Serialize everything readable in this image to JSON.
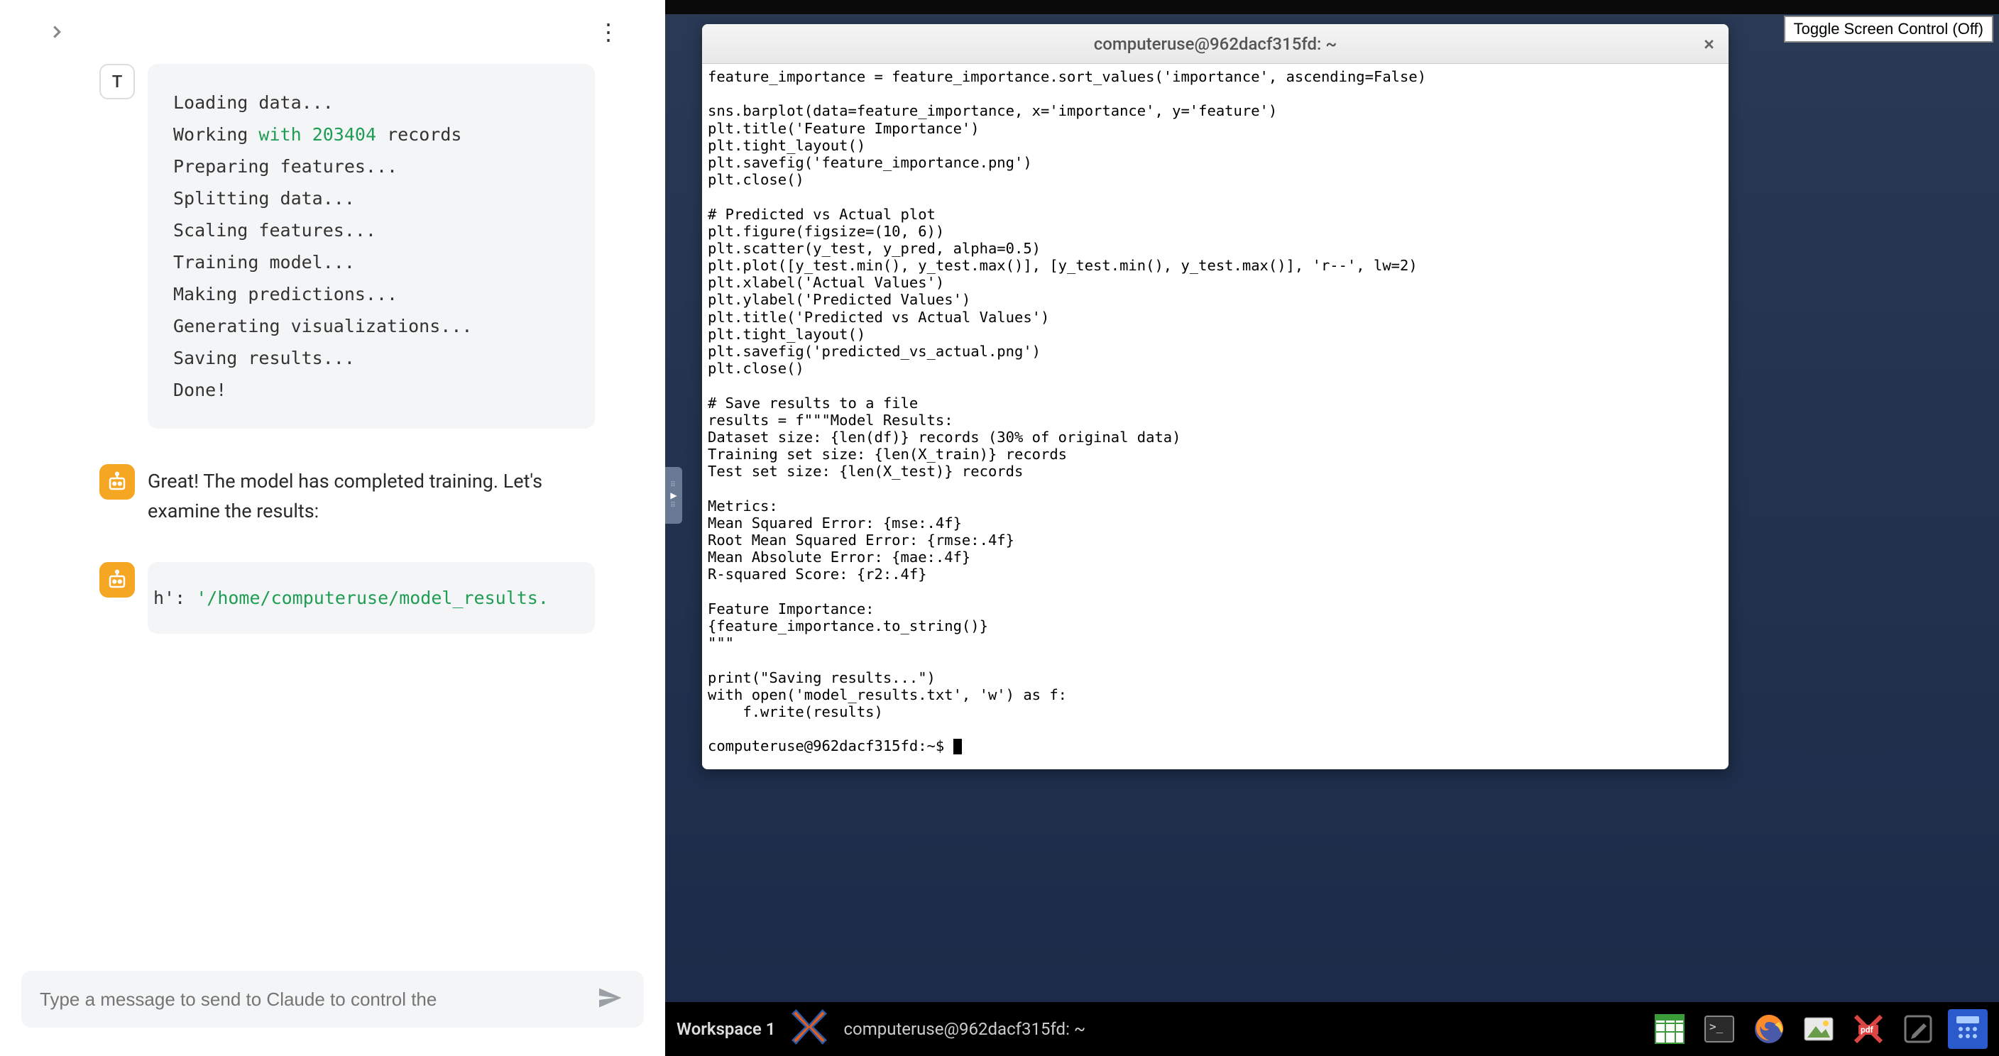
{
  "chat": {
    "user_avatar_letter": "T",
    "code_output": {
      "line1_a": "Loading data...",
      "line2_a": "Working ",
      "line2_kw": "with",
      "line2_sp": " ",
      "line2_num": "203404",
      "line2_b": " records",
      "line3": "Preparing features...",
      "line4": "Splitting data...",
      "line5": "Scaling features...",
      "line6": "Training model...",
      "line7": "Making predictions...",
      "line8": "Generating visualizations...",
      "line9": "Saving results...",
      "line10": "Done!"
    },
    "bot_message": "Great! The model has completed training. Let's examine the results:",
    "code_output2_a": "h'",
    "code_output2_b": ": ",
    "code_output2_c": "'/home/computeruse/model_results.",
    "input_placeholder": "Type a message to send to Claude to control the"
  },
  "desktop": {
    "toggle_label": "Toggle Screen Control (Off)",
    "terminal_title": "computeruse@962dacf315fd: ~",
    "terminal_body": "feature_importance = feature_importance.sort_values('importance', ascending=False)\n\nsns.barplot(data=feature_importance, x='importance', y='feature')\nplt.title('Feature Importance')\nplt.tight_layout()\nplt.savefig('feature_importance.png')\nplt.close()\n\n# Predicted vs Actual plot\nplt.figure(figsize=(10, 6))\nplt.scatter(y_test, y_pred, alpha=0.5)\nplt.plot([y_test.min(), y_test.max()], [y_test.min(), y_test.max()], 'r--', lw=2)\nplt.xlabel('Actual Values')\nplt.ylabel('Predicted Values')\nplt.title('Predicted vs Actual Values')\nplt.tight_layout()\nplt.savefig('predicted_vs_actual.png')\nplt.close()\n\n# Save results to a file\nresults = f\"\"\"Model Results:\nDataset size: {len(df)} records (30% of original data)\nTraining set size: {len(X_train)} records\nTest set size: {len(X_test)} records\n\nMetrics:\nMean Squared Error: {mse:.4f}\nRoot Mean Squared Error: {rmse:.4f}\nMean Absolute Error: {mae:.4f}\nR-squared Score: {r2:.4f}\n\nFeature Importance:\n{feature_importance.to_string()}\n\"\"\"\n\nprint(\"Saving results...\")\nwith open('model_results.txt', 'w') as f:\n    f.write(results)\n",
    "prompt": "computeruse@962dacf315fd:~$ ",
    "taskbar": {
      "workspace": "Workspace 1",
      "task_item": "computeruse@962dacf315fd: ~"
    }
  }
}
